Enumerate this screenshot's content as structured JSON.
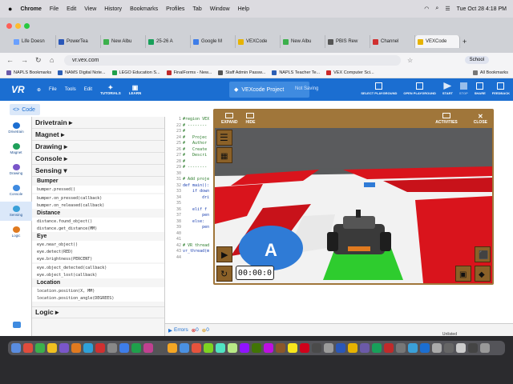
{
  "menubar": {
    "app": "Chrome",
    "items": [
      "File",
      "Edit",
      "View",
      "History",
      "Bookmarks",
      "Profiles",
      "Tab",
      "Window",
      "Help"
    ],
    "clock": "Tue Oct 28  4:18 PM"
  },
  "tabs": [
    {
      "label": "Life Doesn",
      "color": "#6aa0ff"
    },
    {
      "label": "PowerTea",
      "color": "#2a57b8"
    },
    {
      "label": "New Albu",
      "color": "#3cb04c"
    },
    {
      "label": "25-26 A",
      "color": "#18a05a"
    },
    {
      "label": "Google M",
      "color": "#3e7de8"
    },
    {
      "label": "VEXCode",
      "color": "#e6b300"
    },
    {
      "label": "New Albu",
      "color": "#3cb04c"
    },
    {
      "label": "PBIS Rew",
      "color": "#555555"
    },
    {
      "label": "Channel",
      "color": "#d03030"
    },
    {
      "label": "VEXCode",
      "color": "#e6b300",
      "active": true
    }
  ],
  "address": {
    "url": "vr.vex.com",
    "profile": "School"
  },
  "bookmarks": [
    {
      "label": "NAPLS Bookmarks",
      "color": "#6b5aa8"
    },
    {
      "label": "NAMS Digital Note...",
      "color": "#2c5fb5"
    },
    {
      "label": "LEGO Education S...",
      "color": "#1fa04b"
    },
    {
      "label": "FinalForms - New...",
      "color": "#c02a2a"
    },
    {
      "label": "Staff Admin Passw...",
      "color": "#555555"
    },
    {
      "label": "NAPLS Teacher Te...",
      "color": "#2c5fb5"
    },
    {
      "label": "VEX Computer Sci...",
      "color": "#cc2a2a"
    },
    {
      "label": "All Bookmarks",
      "color": "#777777"
    }
  ],
  "vexbar": {
    "logo": "VR",
    "file": "File",
    "tools": "Tools",
    "edit": "Edit",
    "tutorials": "TUTORIALS",
    "learn": "LEARN",
    "project": "VEXcode Project",
    "saving": "Not Saving",
    "buttons": [
      "SELECT PLAYGROUND",
      "OPEN PLAYGROUND",
      "START",
      "STOP",
      "SHARE",
      "FEEDBACK"
    ]
  },
  "codetab": "Code",
  "categories": [
    {
      "label": "Drivetrain",
      "color": "#1b6ed1"
    },
    {
      "label": "Magnet",
      "color": "#1fa05a"
    },
    {
      "label": "Drawing",
      "color": "#7a56c9"
    },
    {
      "label": "Console",
      "color": "#3f8be0"
    },
    {
      "label": "Sensing",
      "color": "#3aa0d8",
      "active": true
    },
    {
      "label": "Logic",
      "color": "#e07a1f"
    }
  ],
  "flyout": {
    "drivetrain": "Drivetrain ▸",
    "magnet": "Magnet ▸",
    "drawing": "Drawing ▸",
    "console": "Console ▸",
    "sensing": "Sensing ▾",
    "bumper": "Bumper",
    "bumper_cmds": [
      "bumper.pressed()",
      "bumper.on_pressed(callback)",
      "bumper.on_released(callback)"
    ],
    "distance": "Distance",
    "distance_cmds": [
      "distance.found_object()",
      "distance.get_distance(MM)"
    ],
    "eye": "Eye",
    "eye_cmds": [
      "eye.near_object()",
      "eye.detect(RED)",
      "eye.brightness(PERCENT)",
      "eye.object_detected(callback)",
      "eye.object_lost(callback)"
    ],
    "location": "Location",
    "location_cmds": [
      "location.position(X, MM)",
      "location.position_angle(DEGREES)"
    ],
    "logic": "Logic ▸"
  },
  "editor": {
    "lines": [
      "1",
      "22",
      "23",
      "24",
      "25",
      "26",
      "27",
      "28",
      "29",
      "30",
      "31",
      "32",
      "33",
      "34",
      "35",
      "36",
      "37",
      "38",
      "39",
      "40",
      "41",
      "42",
      "43",
      "44"
    ],
    "code": [
      "#region VEX",
      "# --------",
      "#",
      "#   Projec",
      "#   Author",
      "#   Create",
      "#   Descri",
      "#",
      "# --------",
      "",
      "# Add proje",
      "def main():",
      "    if down",
      "        dri",
      "",
      "    elif f",
      "        pen",
      "    else:",
      "        pen",
      "",
      "",
      "# VR thread",
      "vr_thread(m",
      ""
    ]
  },
  "errors": {
    "label": "Errors",
    "count_errors": "0",
    "count_warnings": "0"
  },
  "status": "Unlisted",
  "playground": {
    "expand": "EXPAND",
    "hide": "HIDE",
    "activities": "ACTIVITIES",
    "close": "CLOSE",
    "timer": "00:00:0"
  }
}
